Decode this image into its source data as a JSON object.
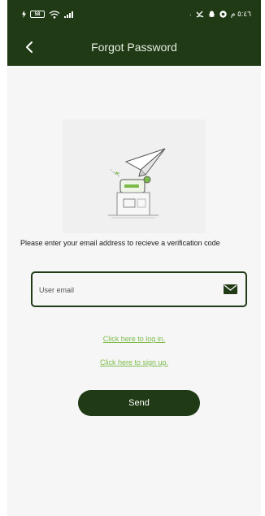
{
  "status_bar": {
    "battery": "58",
    "time": "٥:٤٦ م"
  },
  "app_bar": {
    "title": "Forgot Password"
  },
  "form": {
    "instruction": "Please enter your email address to recieve a verification code",
    "email_placeholder": "User email",
    "email_value": ""
  },
  "links": {
    "login": "Click here to log in.",
    "signup": "Click here to sign up."
  },
  "actions": {
    "send": "Send"
  },
  "colors": {
    "primary": "#1f3a14",
    "link": "#7cbb4a",
    "background": "#f6f6f6"
  },
  "icons": {
    "back": "arrow-back-icon",
    "email": "mail-icon",
    "illustration": "paper-plane-icon"
  }
}
